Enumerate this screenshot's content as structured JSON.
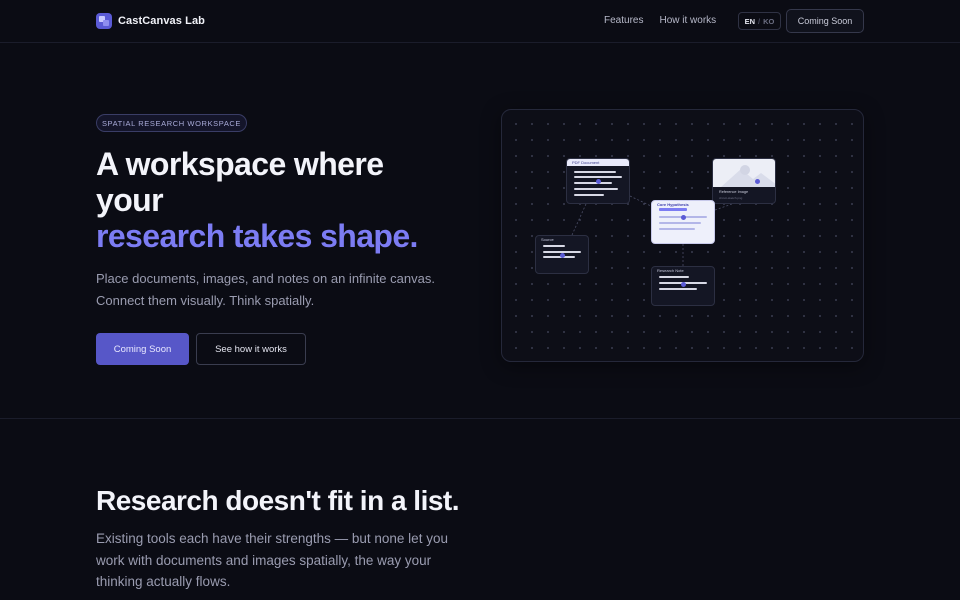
{
  "nav": {
    "brand": "CastCanvas Lab",
    "links": [
      "Features",
      "How it works"
    ],
    "lang_active": "EN",
    "lang_sep": "/",
    "lang_inactive": "KO",
    "cta": "Coming Soon"
  },
  "hero": {
    "badge": "SPATIAL RESEARCH WORKSPACE",
    "title_line": "A workspace where your",
    "title_accent": "research takes shape.",
    "subtitle": "Place documents, images, and notes on an infinite canvas. Connect them visually. Think spatially.",
    "primary_button": "Coming Soon",
    "secondary_button": "See how it works"
  },
  "canvas": {
    "cards": {
      "pdf": "PDF Document",
      "image": "Reference Image",
      "image_file": "circuit-sketch.png",
      "hypothesis": "Core Hypothesis",
      "source": "Source",
      "note": "Research Note"
    }
  },
  "section": {
    "title": "Research doesn't fit in a list.",
    "subtitle": "Existing tools each have their strengths — but none let you work with documents and images spatially, the way your thinking actually flows."
  },
  "colors": {
    "background": "#0b0c14",
    "accent": "#7c7cf3",
    "primary_button": "#5757c8"
  }
}
